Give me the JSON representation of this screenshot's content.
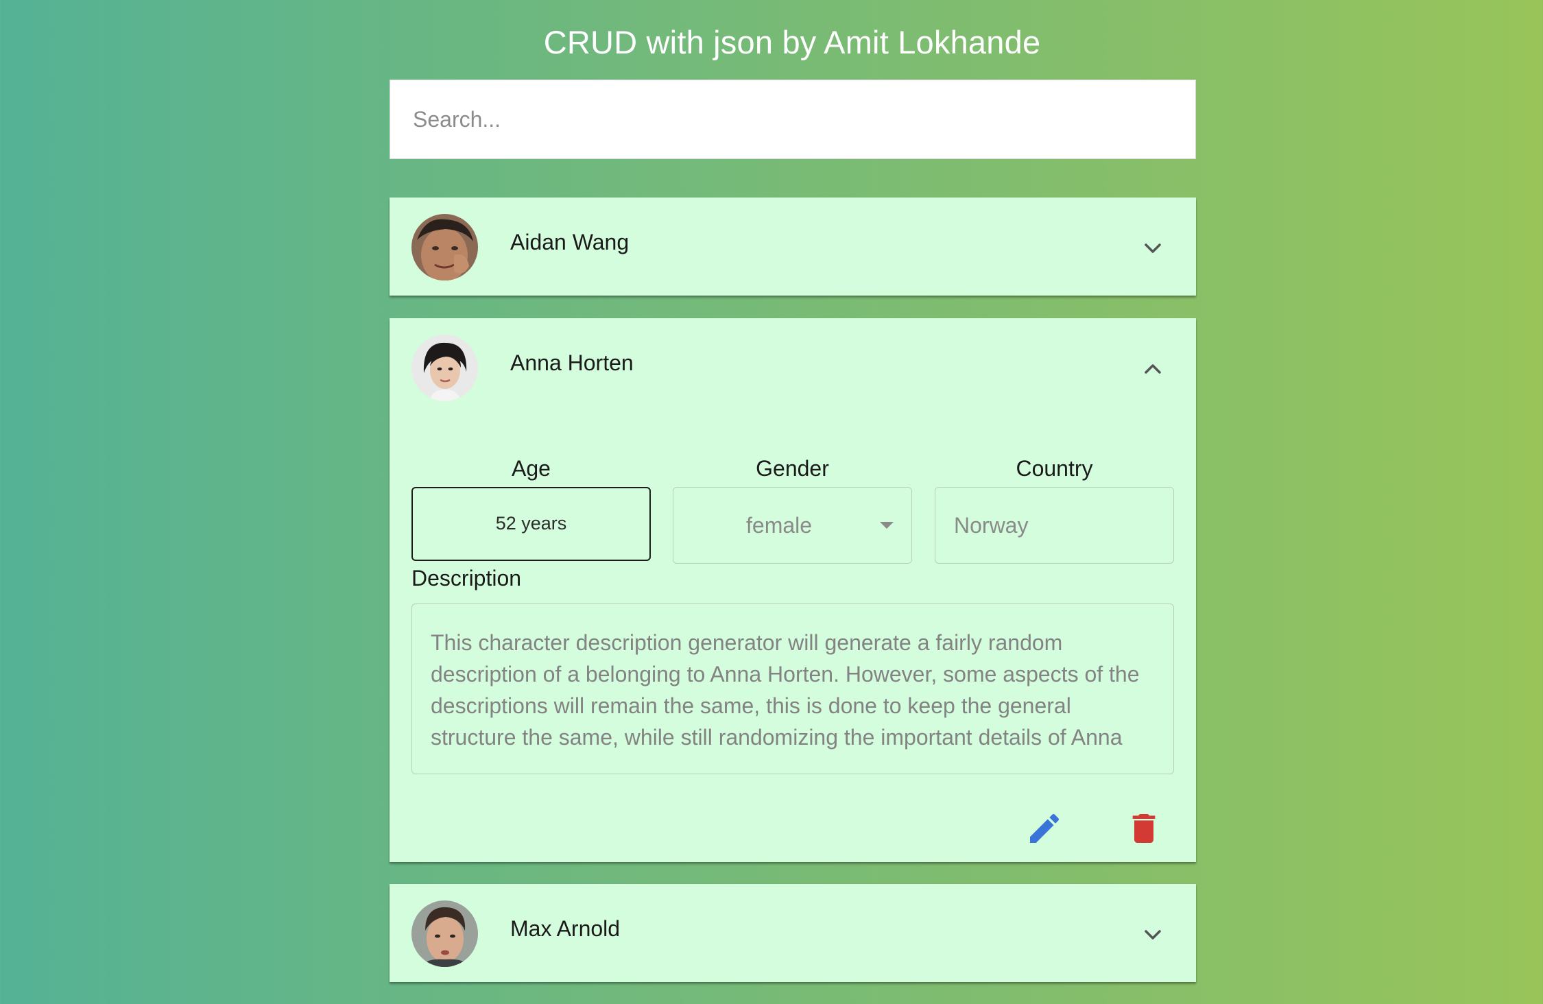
{
  "header": {
    "title": "CRUD with json by Amit Lokhande"
  },
  "search": {
    "placeholder": "Search..."
  },
  "people": [
    {
      "name": "Aidan Wang",
      "expanded": false
    },
    {
      "name": "Anna Horten",
      "expanded": true,
      "age_label": "Age",
      "age_value": "52 years",
      "gender_label": "Gender",
      "gender_value": "female",
      "country_label": "Country",
      "country_value": "Norway",
      "description_label": "Description",
      "description": "This character description generator will generate a fairly random description of a belonging to Anna Horten. However, some aspects of the descriptions will remain the same, this is done to keep the general structure the same, while still randomizing the important details of Anna"
    },
    {
      "name": "Max Arnold",
      "expanded": false
    }
  ],
  "icons": {
    "collapsed": "chevron-down-icon",
    "expanded": "chevron-up-icon",
    "edit": "pencil-icon",
    "delete": "trash-icon",
    "dropdown": "caret-down-icon"
  },
  "colors": {
    "card_background": "#d3fddc",
    "edit": "#3a74d8",
    "delete": "#d43a34",
    "gradient_start": "#55b295",
    "gradient_end": "#98c45a"
  }
}
